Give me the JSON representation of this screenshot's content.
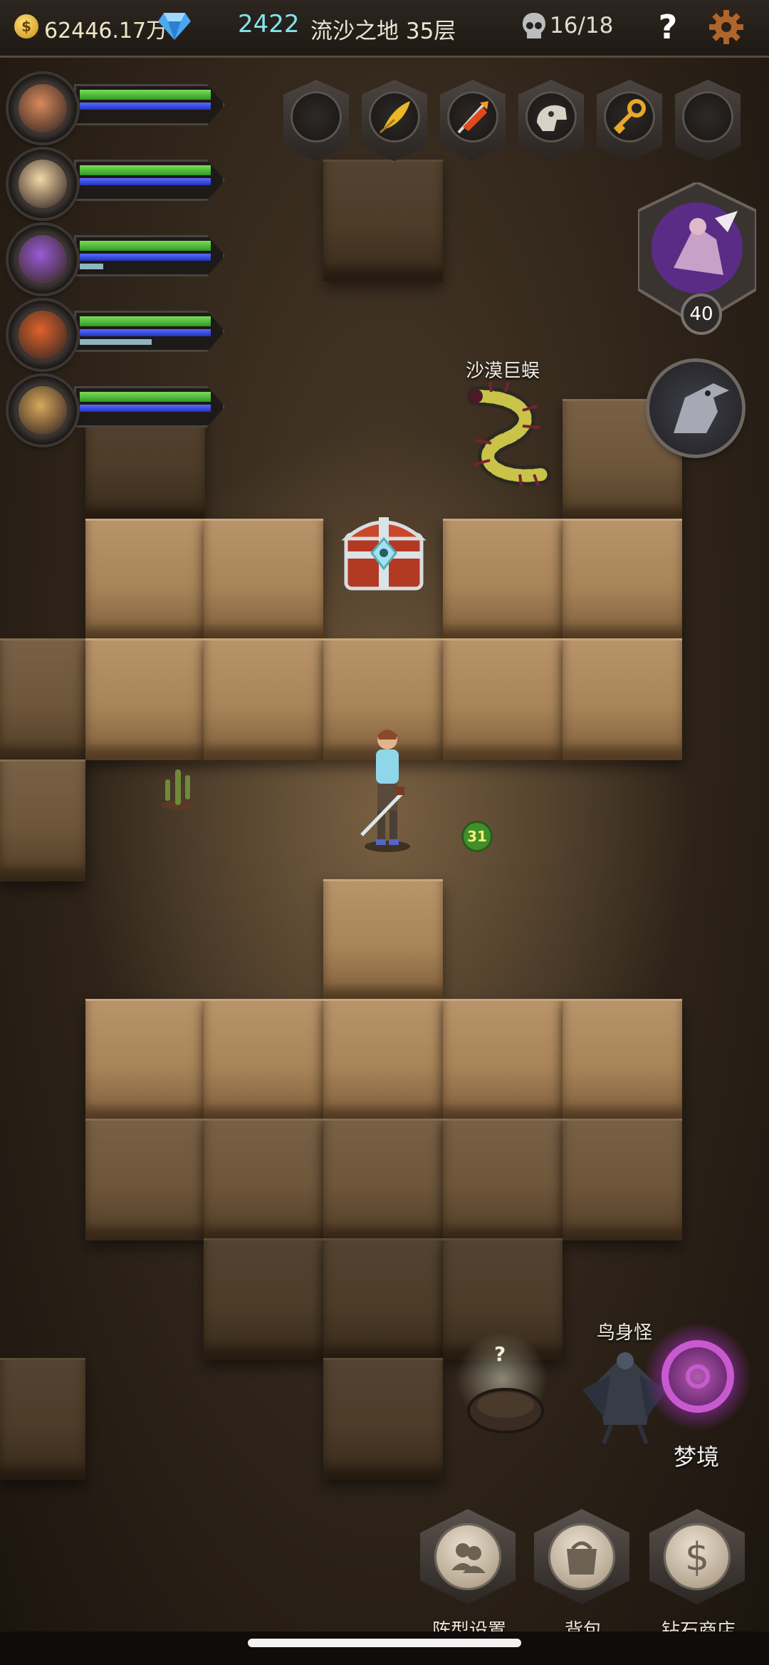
{
  "header": {
    "gold": "62446.17万",
    "gems": "2422",
    "location": "流沙之地 35层",
    "kills": "16/18",
    "help_label": "?",
    "coin_symbol": "$"
  },
  "party": [
    {
      "name_icon": "hero-portrait-1",
      "hp": 1.0,
      "mp": 1.0,
      "xp": 0.0
    },
    {
      "name_icon": "hero-portrait-2",
      "hp": 1.0,
      "mp": 1.0,
      "xp": 0.0
    },
    {
      "name_icon": "hero-portrait-3",
      "hp": 1.0,
      "mp": 1.0,
      "xp": 0.18
    },
    {
      "name_icon": "hero-portrait-4",
      "hp": 1.0,
      "mp": 1.0,
      "xp": 0.55
    },
    {
      "name_icon": "hero-portrait-5",
      "hp": 1.0,
      "mp": 1.0,
      "xp": 0.0
    }
  ],
  "item_slots": [
    "empty",
    "golden-feather-icon",
    "fire-arrow-icon",
    "beast-skull-icon",
    "golden-key-icon",
    "empty"
  ],
  "boss": {
    "level": "40"
  },
  "map": {
    "enemy_1": "沙漠巨蜈",
    "enemy_2": "鸟身怪",
    "mystery_mark": "?",
    "player_level": "31",
    "dream_label": "梦境"
  },
  "bottom_nav": [
    {
      "label": "阵型设置",
      "icon": "formation-icon"
    },
    {
      "label": "背包",
      "icon": "bag-icon"
    },
    {
      "label": "钻石商店",
      "icon": "shop-dollar-icon",
      "glyph": "$"
    }
  ],
  "colors": {
    "hp": "#3aa82a",
    "mp": "#2e44d8",
    "gems": "#7fe6ec"
  }
}
